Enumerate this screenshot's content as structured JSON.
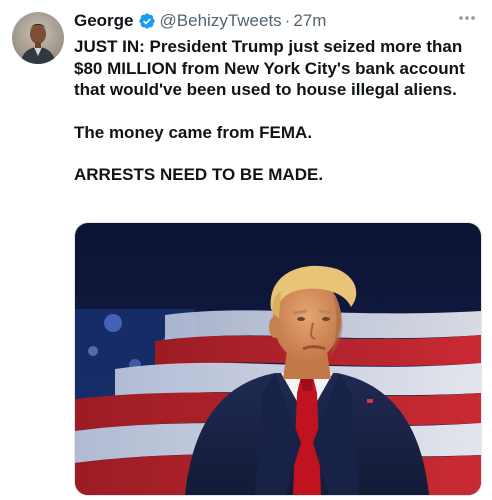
{
  "tweet": {
    "author": {
      "display_name": "George",
      "handle": "@BehizyTweets",
      "separator": "·",
      "time": "27m",
      "verified_icon": "verified-badge-icon",
      "verified_color": "#1d9bf0"
    },
    "paragraphs": [
      "JUST IN: President Trump just seized more than $80 MILLION from New York City's bank account that would've been used to house illegal aliens.",
      "The money came from FEMA.",
      "ARRESTS NEED TO BE MADE."
    ],
    "more_icon": "more-horizontal-icon",
    "media": {
      "kind": "photo",
      "subject": "man-in-suit-with-red-tie-before-american-flag"
    }
  }
}
